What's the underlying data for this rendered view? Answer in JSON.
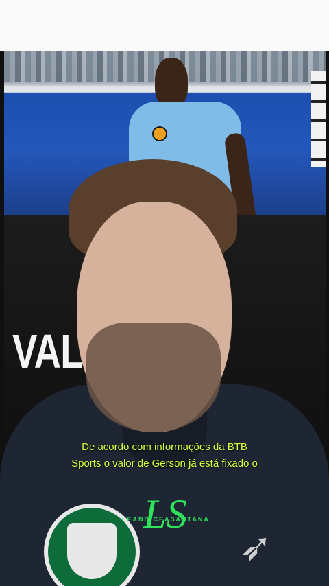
{
  "video": {
    "headline": "VAL    ADO!",
    "subtitle_line1": "De acordo com informações da BTB",
    "subtitle_line2": "Sports o valor de Gerson já está fixado o",
    "watermark_logo": "LS",
    "watermark_handle": "LEANDICEASANTANA",
    "colors": {
      "subtitle": "#d8ff3c",
      "watermark": "#2ee35a"
    }
  }
}
